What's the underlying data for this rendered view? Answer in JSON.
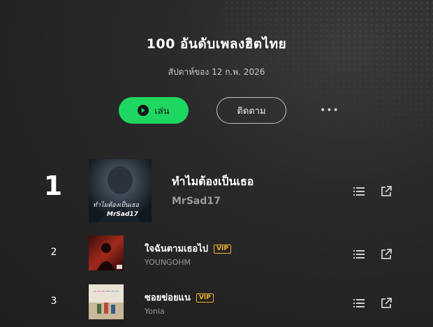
{
  "header": {
    "title": "100 อันดับเพลงฮิตไทย",
    "subtitle": "สัปดาห์ของ 12 ก.พ. 2026"
  },
  "actions": {
    "play_label": "เล่น",
    "follow_label": "ติดตาม",
    "more_label": "•••"
  },
  "tracks": [
    {
      "rank": "1",
      "title": "ทำไมต้องเป็นเธอ",
      "artist": "MrSad17",
      "vip": "",
      "cover_text": "ทำไมต้องเป็นเธอ",
      "cover_sig": "MrSad17"
    },
    {
      "rank": "2",
      "title": "ใจฉันตามเธอไป",
      "artist": "YOUNGOHM",
      "vip": "VIP"
    },
    {
      "rank": "3",
      "title": "ซอยข่อยแน",
      "artist": "Yonia",
      "vip": "VIP"
    }
  ],
  "colors": {
    "accent": "#1ed760",
    "vip": "#f0b429",
    "background": "#262626"
  },
  "icons": [
    "play-icon",
    "queue-icon",
    "share-icon"
  ]
}
